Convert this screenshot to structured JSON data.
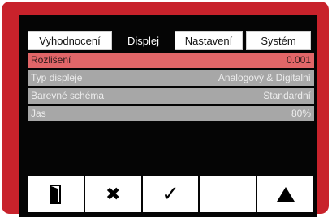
{
  "tabs": [
    {
      "label": "Vyhodnocení",
      "active": false
    },
    {
      "label": "Displej",
      "active": true
    },
    {
      "label": "Nastavení",
      "active": false
    },
    {
      "label": "Systém",
      "active": false
    }
  ],
  "settings": [
    {
      "label": "Rozlišení",
      "value": "0.001",
      "selected": true
    },
    {
      "label": "Typ displeje",
      "value": "Analogový & Digitalní",
      "selected": false
    },
    {
      "label": "Barevné schéma",
      "value": "Standardní",
      "selected": false
    },
    {
      "label": "Jas",
      "value": "80%",
      "selected": false
    }
  ],
  "toolbar": {
    "exit_icon": "door-exit-icon",
    "cancel_icon": "cross-icon",
    "confirm_icon": "checkmark-icon",
    "empty_slot": "",
    "up_icon": "triangle-up-icon"
  },
  "colors": {
    "frame": "#c8222b",
    "screen": "#050505",
    "row": "#a7a7a7",
    "row_selected": "#e16668"
  }
}
